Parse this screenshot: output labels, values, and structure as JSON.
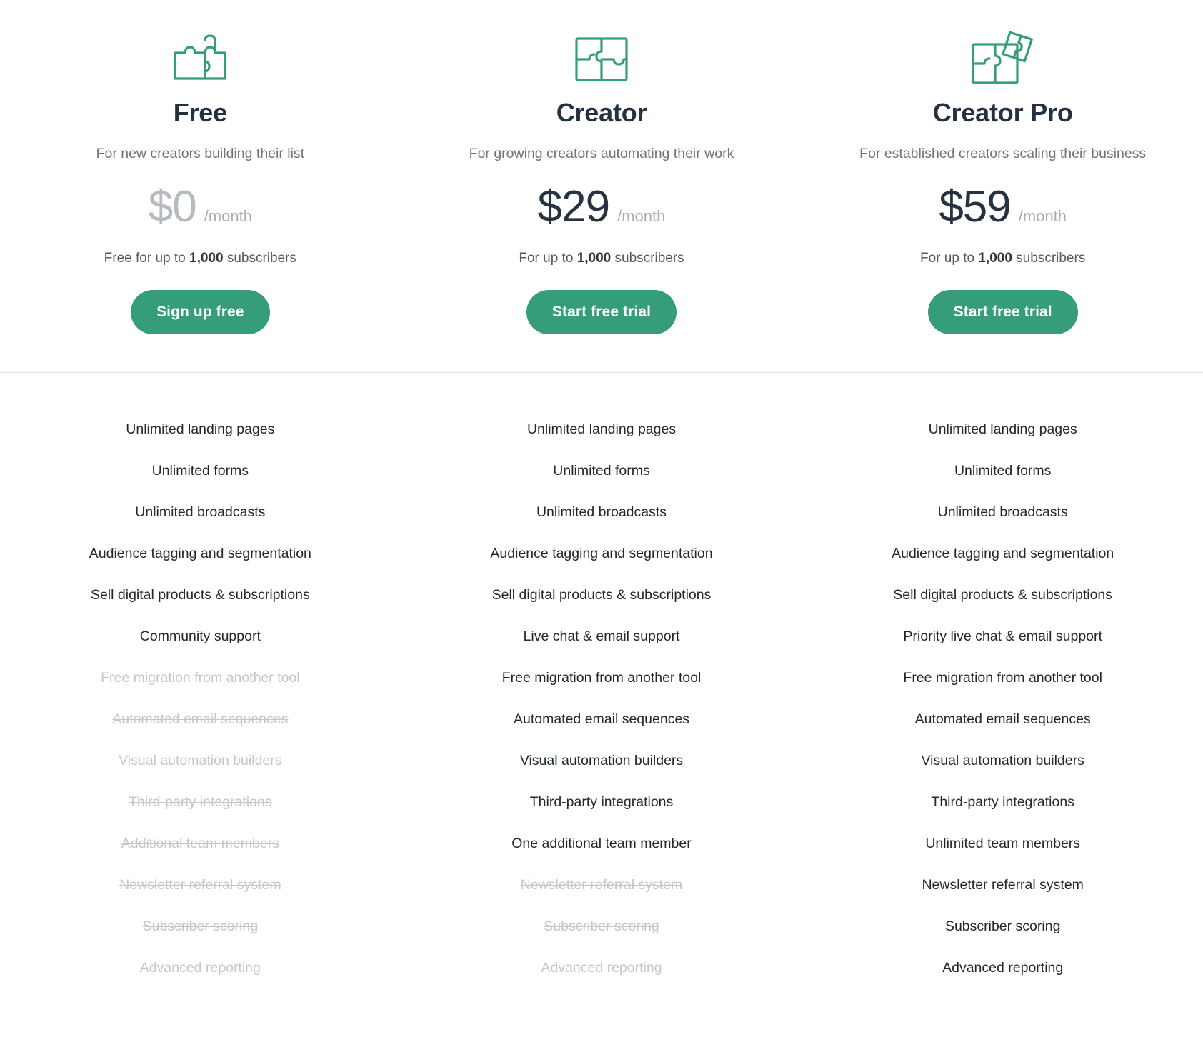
{
  "plans": [
    {
      "icon": "puzzle-two-piece-icon",
      "name": "Free",
      "tagline": "For new creators building their list",
      "price": "$0",
      "price_muted": true,
      "period": "/month",
      "subs_prefix": "Free for up to ",
      "subs_count": "1,000",
      "subs_suffix": " subscribers",
      "cta_label": "Sign up free",
      "features": [
        {
          "label": "Unlimited landing pages",
          "included": true
        },
        {
          "label": "Unlimited forms",
          "included": true
        },
        {
          "label": "Unlimited broadcasts",
          "included": true
        },
        {
          "label": "Audience tagging and segmentation",
          "included": true
        },
        {
          "label": "Sell digital products & subscriptions",
          "included": true
        },
        {
          "label": "Community support",
          "included": true
        },
        {
          "label": "Free migration from another tool",
          "included": false
        },
        {
          "label": "Automated email sequences",
          "included": false
        },
        {
          "label": "Visual automation builders",
          "included": false
        },
        {
          "label": "Third-party integrations",
          "included": false
        },
        {
          "label": "Additional team members",
          "included": false
        },
        {
          "label": "Newsletter referral system",
          "included": false
        },
        {
          "label": "Subscriber scoring",
          "included": false
        },
        {
          "label": "Advanced reporting",
          "included": false
        }
      ]
    },
    {
      "icon": "puzzle-four-piece-icon",
      "name": "Creator",
      "tagline": "For growing creators automating their work",
      "price": "$29",
      "price_muted": false,
      "period": "/month",
      "subs_prefix": "For up to ",
      "subs_count": "1,000",
      "subs_suffix": " subscribers",
      "cta_label": "Start free trial",
      "features": [
        {
          "label": "Unlimited landing pages",
          "included": true
        },
        {
          "label": "Unlimited forms",
          "included": true
        },
        {
          "label": "Unlimited broadcasts",
          "included": true
        },
        {
          "label": "Audience tagging and segmentation",
          "included": true
        },
        {
          "label": "Sell digital products & subscriptions",
          "included": true
        },
        {
          "label": "Live chat & email support",
          "included": true
        },
        {
          "label": "Free migration from another tool",
          "included": true
        },
        {
          "label": "Automated email sequences",
          "included": true
        },
        {
          "label": "Visual automation builders",
          "included": true
        },
        {
          "label": "Third-party integrations",
          "included": true
        },
        {
          "label": "One additional team member",
          "included": true
        },
        {
          "label": "Newsletter referral system",
          "included": false
        },
        {
          "label": "Subscriber scoring",
          "included": false
        },
        {
          "label": "Advanced reporting",
          "included": false
        }
      ]
    },
    {
      "icon": "puzzle-detached-piece-icon",
      "name": "Creator Pro",
      "tagline": "For established creators scaling their business",
      "price": "$59",
      "price_muted": false,
      "period": "/month",
      "subs_prefix": "For up to ",
      "subs_count": "1,000",
      "subs_suffix": " subscribers",
      "cta_label": "Start free trial",
      "features": [
        {
          "label": "Unlimited landing pages",
          "included": true
        },
        {
          "label": "Unlimited forms",
          "included": true
        },
        {
          "label": "Unlimited broadcasts",
          "included": true
        },
        {
          "label": "Audience tagging and segmentation",
          "included": true
        },
        {
          "label": "Sell digital products & subscriptions",
          "included": true
        },
        {
          "label": "Priority live chat & email support",
          "included": true
        },
        {
          "label": "Free migration from another tool",
          "included": true
        },
        {
          "label": "Automated email sequences",
          "included": true
        },
        {
          "label": "Visual automation builders",
          "included": true
        },
        {
          "label": "Third-party integrations",
          "included": true
        },
        {
          "label": "Unlimited team members",
          "included": true
        },
        {
          "label": "Newsletter referral system",
          "included": true
        },
        {
          "label": "Subscriber scoring",
          "included": true
        },
        {
          "label": "Advanced reporting",
          "included": true
        }
      ]
    }
  ],
  "colors": {
    "accent_green": "#359d77",
    "divider_navy": "#2c3e50",
    "separator_gray": "#dfe2e4",
    "text_dark": "#23282d",
    "text_muted": "#6f7478",
    "text_disabled": "#c3c7cb"
  }
}
